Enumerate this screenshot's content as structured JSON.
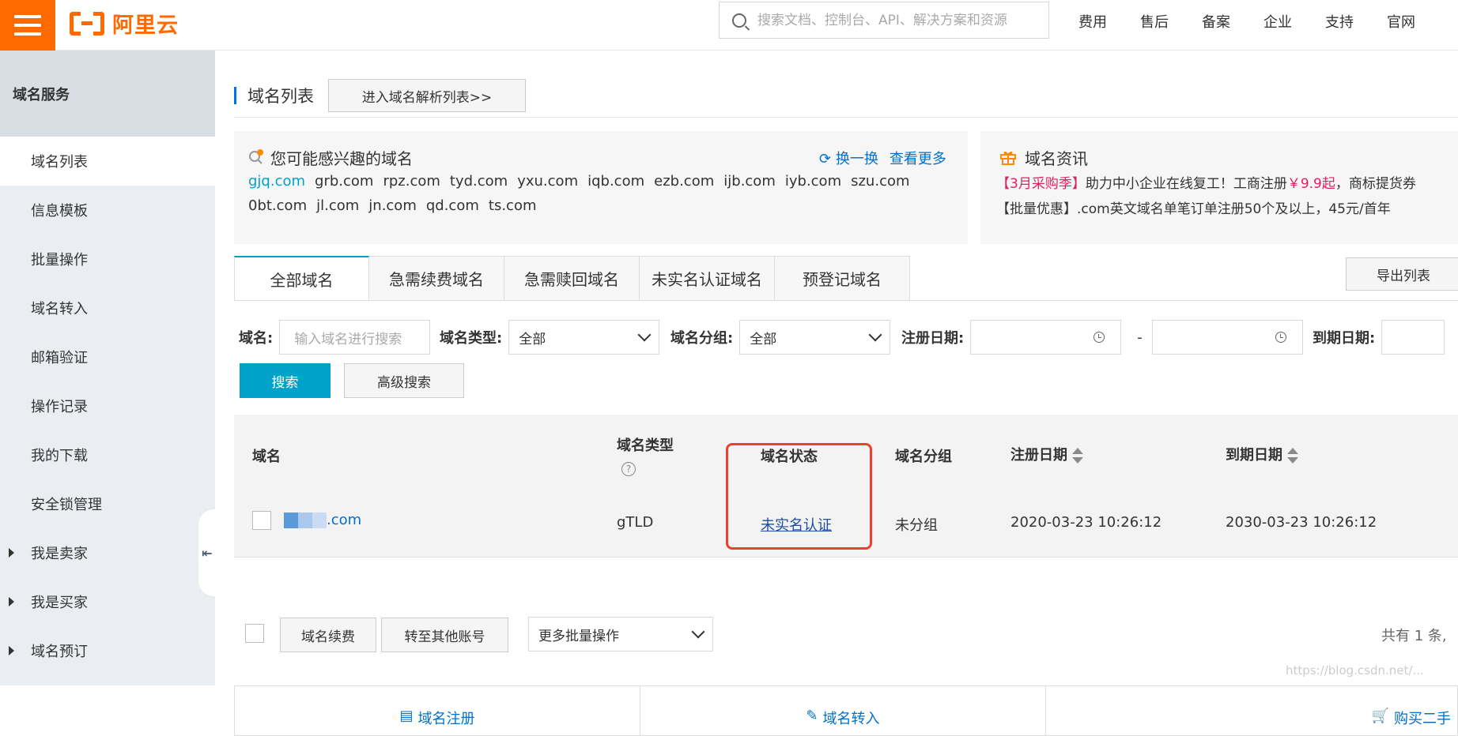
{
  "brand": {
    "logo_text": "阿里云"
  },
  "search": {
    "placeholder": "搜索文档、控制台、API、解决方案和资源"
  },
  "topnav": [
    "费用",
    "售后",
    "备案",
    "企业",
    "支持",
    "官网"
  ],
  "sidebar": {
    "header": "域名服务",
    "items": [
      {
        "label": "域名列表",
        "active": true
      },
      {
        "label": "信息模板"
      },
      {
        "label": "批量操作"
      },
      {
        "label": "域名转入"
      },
      {
        "label": "邮箱验证"
      },
      {
        "label": "操作记录"
      },
      {
        "label": "我的下载"
      },
      {
        "label": "安全锁管理"
      },
      {
        "label": "我是卖家",
        "expandable": true
      },
      {
        "label": "我是买家",
        "expandable": true
      },
      {
        "label": "域名预订",
        "expandable": true
      }
    ],
    "collapse_glyph": "⇤"
  },
  "page": {
    "title": "域名列表",
    "dns_button": "进入域名解析列表>>"
  },
  "suggest": {
    "title": "您可能感兴趣的域名",
    "refresh": "换一换",
    "more": "查看更多",
    "domains": [
      "gjq.com",
      "grb.com",
      "rpz.com",
      "tyd.com",
      "yxu.com",
      "iqb.com",
      "ezb.com",
      "ijb.com",
      "iyb.com",
      "szu.com",
      "0bt.com",
      "jl.com",
      "jn.com",
      "qd.com",
      "ts.com"
    ]
  },
  "news": {
    "title": "域名资讯",
    "line1_tag": "【3月采购季】",
    "line1_text": "助力中小企业在线复工！工商注册",
    "line1_price": "￥9.9起",
    "line1_rest": "，商标提货券",
    "line2": "【批量优惠】.com英文域名单笔订单注册50个及以上，45元/首年"
  },
  "tabs": [
    "全部域名",
    "急需续费域名",
    "急需赎回域名",
    "未实名认证域名",
    "预登记域名"
  ],
  "export_button": "导出列表",
  "filters": {
    "domain_label": "域名:",
    "domain_placeholder": "输入域名进行搜索",
    "type_label": "域名类型:",
    "type_value": "全部",
    "group_label": "域名分组:",
    "group_value": "全部",
    "reg_label": "注册日期:",
    "dash": "-",
    "exp_label": "到期日期:",
    "search_button": "搜索",
    "advanced_button": "高级搜索"
  },
  "table": {
    "columns": {
      "domain": "域名",
      "type": "域名类型",
      "status": "域名状态",
      "group": "域名分组",
      "reg_date": "注册日期",
      "exp_date": "到期日期"
    },
    "rows": [
      {
        "domain_suffix": ".com",
        "type": "gTLD",
        "status": "未实名认证",
        "group": "未分组",
        "reg_date": "2020-03-23 10:26:12",
        "exp_date": "2030-03-23 10:26:12"
      }
    ]
  },
  "batch": {
    "renew": "域名续费",
    "transfer": "转至其他账号",
    "more": "更多批量操作",
    "total": "共有 1 条,"
  },
  "bottom_actions": [
    "域名注册",
    "域名转入",
    "购买二手"
  ],
  "watermark": "https://blog.csdn.net/..."
}
